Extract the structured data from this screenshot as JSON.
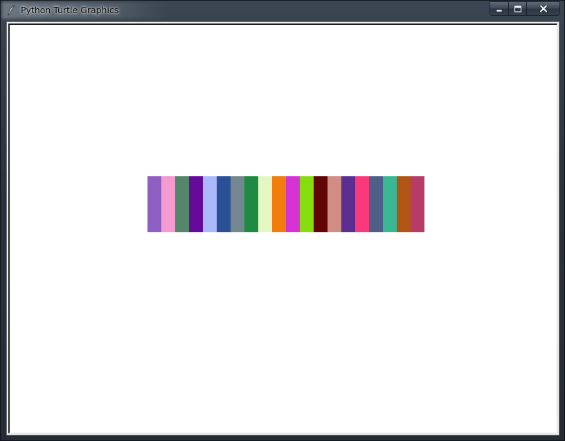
{
  "window": {
    "title": "Python Turtle Graphics",
    "icon": "feather-icon"
  },
  "caption_buttons": {
    "minimize_icon": "minimize-icon",
    "maximize_icon": "maximize-icon",
    "close_icon": "close-icon",
    "minimize_glyph": "▁",
    "maximize_glyph": "□",
    "close_glyph": "✕"
  },
  "canvas": {
    "background": "#ffffff",
    "stripes": [
      "#8d5fc2",
      "#f59acf",
      "#54876a",
      "#650b99",
      "#aab9fc",
      "#2b5096",
      "#728791",
      "#1f8a41",
      "#e4f6c3",
      "#f07d0c",
      "#d733d4",
      "#86de0e",
      "#620506",
      "#d18c84",
      "#5b2d91",
      "#f93979",
      "#4e6088",
      "#3ab894",
      "#b15512",
      "#b83b67"
    ]
  }
}
